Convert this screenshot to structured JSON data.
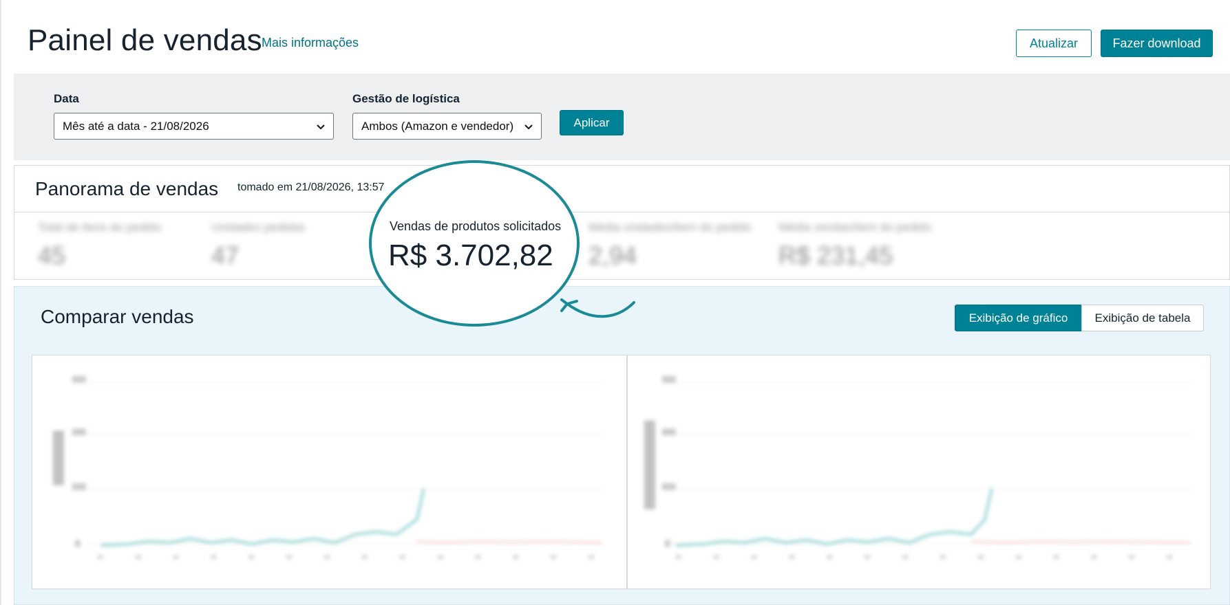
{
  "header": {
    "title": "Painel de vendas",
    "more_info": "Mais informações",
    "refresh_label": "Atualizar",
    "download_label": "Fazer download"
  },
  "filters": {
    "date_label": "Data",
    "date_value": "Mês até a data - 21/08/2026",
    "logistics_label": "Gestão de logística",
    "logistics_value": "Ambos (Amazon e vendedor)",
    "apply_label": "Aplicar"
  },
  "overview": {
    "title": "Panorama de vendas",
    "timestamp": "tomado em 21/08/2026, 13:57",
    "metrics": [
      {
        "label": "Total de itens do pedido",
        "value": "45"
      },
      {
        "label": "Unidades pedidas",
        "value": "47"
      },
      {
        "label": "Média unidades/item do pedido",
        "value": "2,94"
      },
      {
        "label": "Média vendas/item do pedido",
        "value": "R$ 231,45"
      }
    ],
    "highlight": {
      "label": "Vendas de produtos solicitados",
      "value": "R$ 3.702,82"
    }
  },
  "compare": {
    "title": "Comparar vendas",
    "graph_view_label": "Exibição de gráfico",
    "table_view_label": "Exibição de tabela"
  },
  "colors": {
    "accent": "#008296",
    "highlight_ring": "#1a8a94",
    "panel_bg": "#eeeff0",
    "compare_bg": "#e9f5fb",
    "series_current": "#2aa6a6",
    "series_previous": "#f29b8a"
  }
}
